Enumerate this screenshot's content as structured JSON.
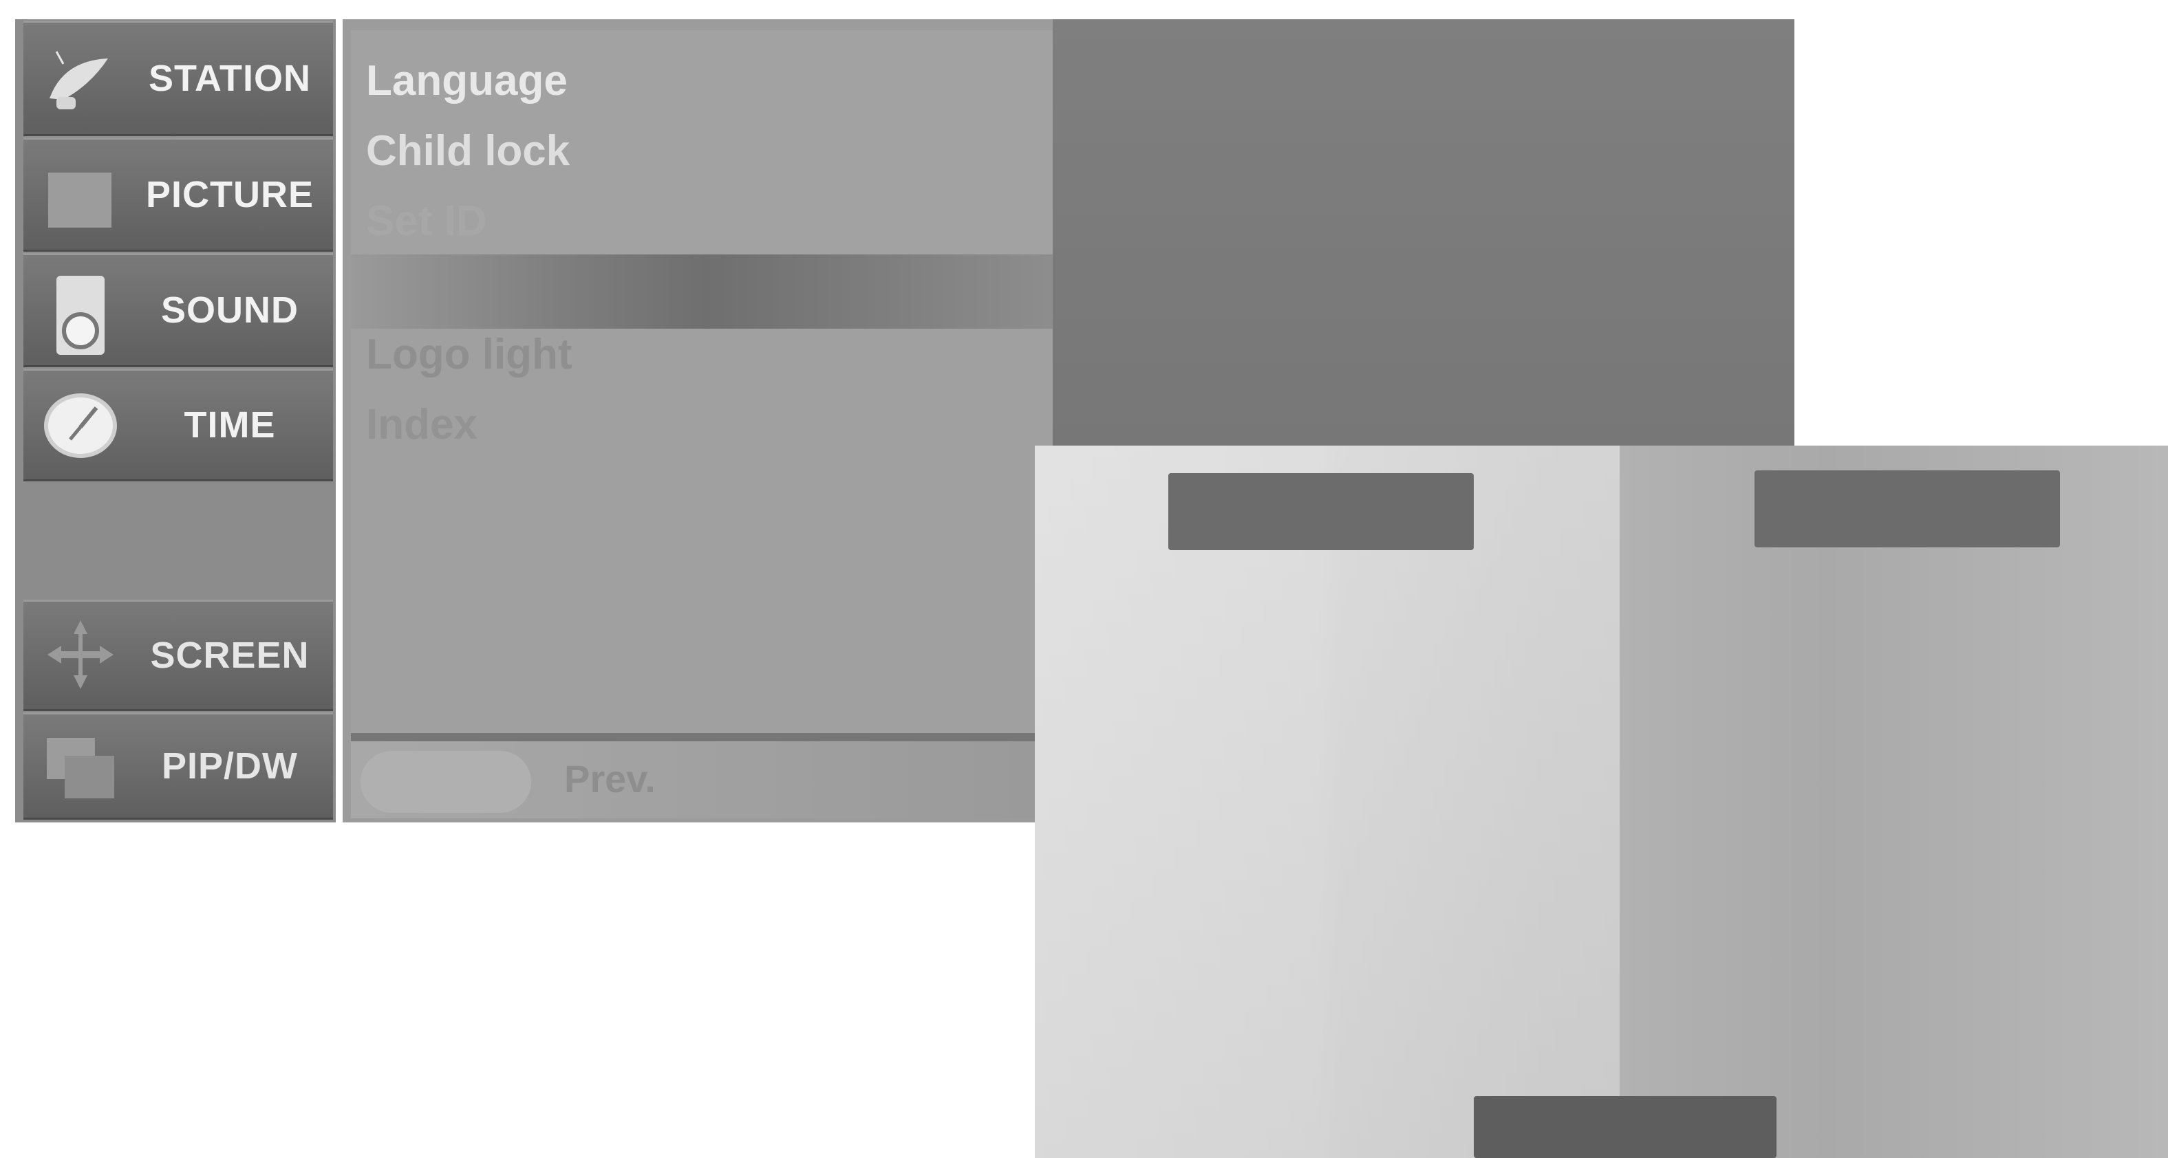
{
  "menu": {
    "items": [
      {
        "label": "STATION",
        "icon": "satellite-dish-icon"
      },
      {
        "label": "PICTURE",
        "icon": "picture-square-icon"
      },
      {
        "label": "SOUND",
        "icon": "speaker-icon"
      },
      {
        "label": "TIME",
        "icon": "clock-icon"
      },
      {
        "label": "SCREEN",
        "icon": "move-arrows-icon"
      },
      {
        "label": "PIP/DW",
        "icon": "pip-windows-icon"
      }
    ]
  },
  "submenu": {
    "items": [
      {
        "label": "Language"
      },
      {
        "label": "Child lock"
      },
      {
        "label": "Set ID"
      },
      {
        "label": "Logo light"
      },
      {
        "label": "Index"
      }
    ],
    "footer": {
      "prev_label": "Prev."
    }
  },
  "colors": {
    "menu_button": "#6c6c6c",
    "submenu_bg": "#a0a0a0",
    "overlay": "#7c7c7c"
  }
}
